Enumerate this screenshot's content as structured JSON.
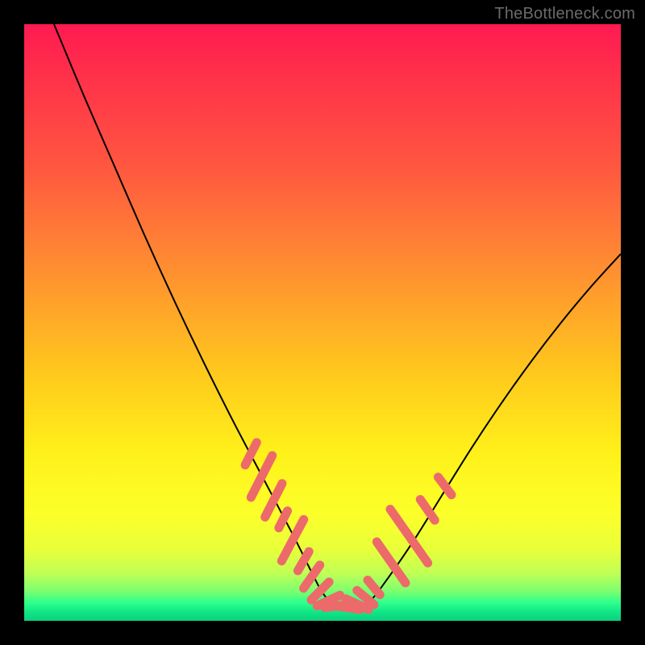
{
  "attribution": "TheBottleneck.com",
  "colors": {
    "curve": "#000000",
    "marker_fill": "#ec6a6a",
    "marker_stroke": "#ec6a6a",
    "frame": "#000000"
  },
  "chart_data": {
    "type": "line",
    "title": "",
    "xlabel": "",
    "ylabel": "",
    "xlim": [
      0,
      100
    ],
    "ylim": [
      0,
      100
    ],
    "grid": false,
    "legend_position": "none",
    "description": "V-shaped bottleneck curve on a red→green vertical gradient. The black curve descends steeply from the top-left, reaches a flat minimum near the bottom around x≈47–56, then rises toward the upper right with decreasing slope. Salmon-colored elongated markers (tablet/pill shaped) lie along the lower portion of the curve on both flanks of the valley.",
    "series": [
      {
        "name": "bottleneck-curve",
        "x": [
          5,
          10,
          15,
          20,
          25,
          30,
          35,
          40,
          45,
          48,
          50,
          52,
          54,
          56,
          58,
          60,
          65,
          70,
          75,
          80,
          85,
          90,
          95,
          100
        ],
        "values": [
          100,
          88,
          76.5,
          65,
          54,
          43.5,
          33.5,
          24,
          14.5,
          8.5,
          4.7,
          2.6,
          2.0,
          2.2,
          3.4,
          5.8,
          13.0,
          21.0,
          29.0,
          36.5,
          43.5,
          50.0,
          56.0,
          61.5
        ]
      }
    ],
    "markers": [
      {
        "x": 38.0,
        "y": 28.0,
        "len": 2.2,
        "angle": -63
      },
      {
        "x": 39.8,
        "y": 24.2,
        "len": 3.6,
        "angle": -63
      },
      {
        "x": 41.8,
        "y": 20.2,
        "len": 3.0,
        "angle": -63
      },
      {
        "x": 43.4,
        "y": 17.0,
        "len": 1.8,
        "angle": -63
      },
      {
        "x": 45.0,
        "y": 13.5,
        "len": 3.6,
        "angle": -62
      },
      {
        "x": 46.8,
        "y": 10.0,
        "len": 2.0,
        "angle": -60
      },
      {
        "x": 48.2,
        "y": 7.4,
        "len": 2.4,
        "angle": -55
      },
      {
        "x": 49.6,
        "y": 5.0,
        "len": 2.2,
        "angle": -45
      },
      {
        "x": 51.0,
        "y": 3.4,
        "len": 2.2,
        "angle": -25
      },
      {
        "x": 52.5,
        "y": 2.5,
        "len": 2.2,
        "angle": -8
      },
      {
        "x": 54.2,
        "y": 2.2,
        "len": 2.2,
        "angle": 8
      },
      {
        "x": 55.8,
        "y": 2.8,
        "len": 2.2,
        "angle": 25
      },
      {
        "x": 57.2,
        "y": 3.9,
        "len": 2.0,
        "angle": 40
      },
      {
        "x": 58.6,
        "y": 5.6,
        "len": 1.8,
        "angle": 50
      },
      {
        "x": 61.5,
        "y": 9.8,
        "len": 3.8,
        "angle": 55
      },
      {
        "x": 64.5,
        "y": 14.2,
        "len": 4.8,
        "angle": 55
      },
      {
        "x": 67.6,
        "y": 18.6,
        "len": 2.2,
        "angle": 55
      },
      {
        "x": 70.5,
        "y": 22.6,
        "len": 2.0,
        "angle": 53
      }
    ]
  }
}
